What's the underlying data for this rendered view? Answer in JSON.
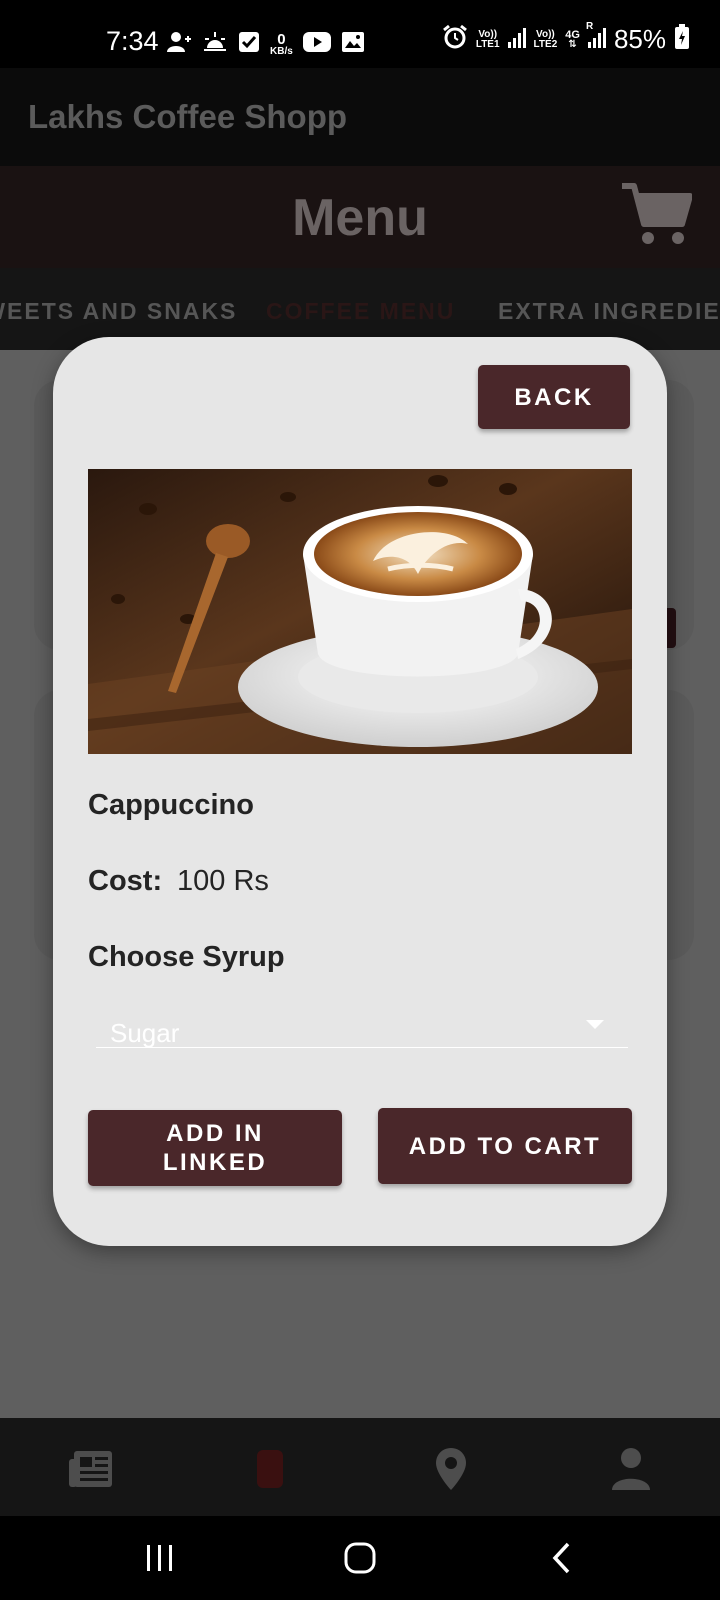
{
  "status_bar": {
    "time": "7:34",
    "data_speed_value": "0",
    "data_speed_unit": "KB/s",
    "sim1_top": "Vo))",
    "sim1_bottom": "LTE1",
    "sim2_top": "Vo))",
    "sim2_bottom": "LTE2",
    "network_type": "4G",
    "roaming": "R",
    "battery": "85%",
    "icons": [
      "person-add-icon",
      "sunrise-icon",
      "checkbox-icon",
      "youtube-icon",
      "gallery-icon",
      "alarm-icon",
      "signal-icon",
      "battery-charging-icon"
    ]
  },
  "app_bar": {
    "title": "Lakhs Coffee Shopp"
  },
  "header": {
    "title": "Menu",
    "cart_icon": "shopping-cart-icon"
  },
  "tabs": [
    {
      "label": "SWEETS AND SNAKS",
      "active": false
    },
    {
      "label": "COFFEE MENU",
      "active": true
    },
    {
      "label": "EXTRA INGREDIENTS",
      "active": false
    }
  ],
  "dialog": {
    "back_label": "BACK",
    "image_alt": "cappuccino-photo",
    "item_name": "Cappuccino",
    "cost_label": "Cost:",
    "cost_value": "100 Rs",
    "syrup_label": "Choose Syrup",
    "syrup_selected": "Sugar",
    "add_linked_label": "ADD IN LINKED",
    "add_to_cart_label": "ADD TO CART"
  },
  "bottom_nav": {
    "items": [
      "news-icon",
      "coffee-cup-icon",
      "location-pin-icon",
      "person-icon"
    ],
    "active_index": 1
  },
  "system_nav": [
    "recents-icon",
    "home-icon",
    "back-icon"
  ],
  "colors": {
    "accent": "#4a272a",
    "dialog_bg": "#e6e6e6",
    "overlay": "#5f5f5f"
  }
}
